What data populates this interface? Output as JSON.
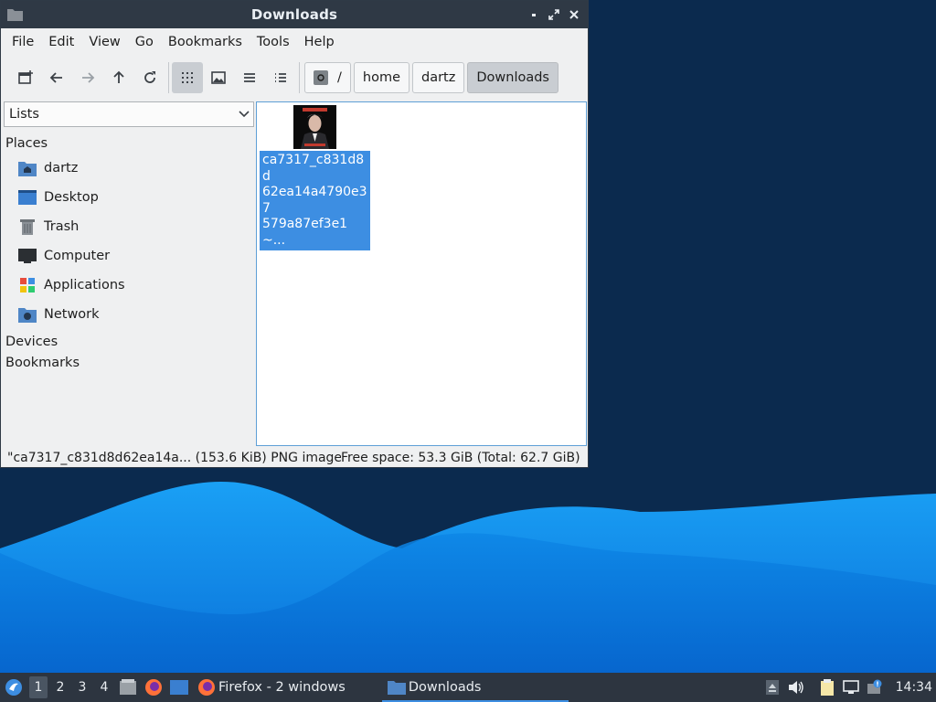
{
  "window": {
    "title": "Downloads",
    "controls": {
      "minimize": "•",
      "maximize": "⤢",
      "close": "✕"
    }
  },
  "menubar": [
    "File",
    "Edit",
    "View",
    "Go",
    "Bookmarks",
    "Tools",
    "Help"
  ],
  "toolbar": {
    "buttons": [
      "new-tab-icon",
      "back-icon",
      "forward-icon",
      "up-icon",
      "reload-icon",
      "icon-view-icon",
      "thumbnail-view-icon",
      "compact-view-icon",
      "detailed-list-icon"
    ],
    "active_view": "icon-view-icon",
    "breadcrumb": [
      "/",
      "home",
      "dartz",
      "Downloads"
    ]
  },
  "sidebar": {
    "selector": "Lists",
    "places_header": "Places",
    "places": [
      {
        "label": "dartz",
        "icon": "home-folder-icon"
      },
      {
        "label": "Desktop",
        "icon": "desktop-icon"
      },
      {
        "label": "Trash",
        "icon": "trash-icon"
      },
      {
        "label": "Computer",
        "icon": "computer-icon"
      },
      {
        "label": "Applications",
        "icon": "applications-icon"
      },
      {
        "label": "Network",
        "icon": "network-icon"
      }
    ],
    "devices_header": "Devices",
    "bookmarks_header": "Bookmarks"
  },
  "files": [
    {
      "name": "ca7317_c831d8d62ea14a4790e37579a87ef3e1~...",
      "display_lines": [
        "ca7317_c831d8d",
        "62ea14a4790e37",
        "579a87ef3e1~..."
      ],
      "selected": true
    }
  ],
  "statusbar": {
    "selection": "\"ca7317_c831d8d62ea14a... (153.6 KiB) PNG image",
    "free_space": "Free space: 53.3 GiB (Total: 62.7 GiB)"
  },
  "taskbar": {
    "workspaces": [
      "1",
      "2",
      "3",
      "4"
    ],
    "active_workspace": "1",
    "tasks": [
      {
        "label": "Firefox - 2 windows",
        "icon": "firefox-icon"
      },
      {
        "label": "Downloads",
        "icon": "folder-icon",
        "active": true
      }
    ],
    "clock": "14:34"
  },
  "colors": {
    "accent": "#3d8ee2",
    "titlebar": "#2f3945",
    "taskbar": "#2d3540",
    "wallpaper_dark": "#0b2a4e",
    "wallpaper_light": "#1a9bf0"
  }
}
